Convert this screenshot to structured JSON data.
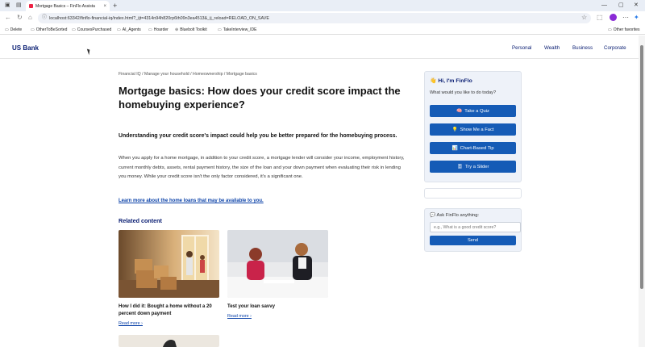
{
  "browser": {
    "tab_title": "Mortgage Basics – FinFlo Assista",
    "tab_close": "×",
    "new_tab": "+",
    "url": "localhost:63342/finflo-financial-iq/index.html?_ijt=4314n94h820rp6th09n3ea4513&_ij_reload=RELOAD_ON_SAVE",
    "bookmarks": [
      {
        "icon": "▭",
        "label": "Delete"
      },
      {
        "icon": "▭",
        "label": "OtherToBeSorted"
      },
      {
        "icon": "▭",
        "label": "CoursesPurchased"
      },
      {
        "icon": "▭",
        "label": "AI_Agents"
      },
      {
        "icon": "▭",
        "label": "Hoarder"
      },
      {
        "icon": "⊕",
        "label": "Bluebolt Toolkit"
      },
      {
        "icon": "▭",
        "label": "TakeInterview_IDE"
      }
    ],
    "other_favorites": "Other favorites",
    "icons": {
      "back": "←",
      "refresh": "↻",
      "home": "⌂",
      "site_info": "ⓘ",
      "star": "☆",
      "minimize": "—",
      "maximize": "▢",
      "close": "✕",
      "extensions": "⬚",
      "menu": "⋯"
    }
  },
  "site": {
    "brand": "US Bank",
    "nav": [
      "Personal",
      "Wealth",
      "Business",
      "Corporate"
    ]
  },
  "article": {
    "breadcrumb": "Financial IQ / Manage your household / Homeownership / Mortgage basics",
    "title": "Mortgage basics: How does your credit score impact the homebuying experience?",
    "subtitle": "Understanding your credit score's impact could help you be better prepared for the homebuying process.",
    "body": "When you apply for a home mortgage, in addition to your credit score, a mortgage lender will consider your income, employment history, current monthly debts, assets, rental payment history, the size of the loan and your down payment when evaluating their risk in lending you money. While your credit score isn't the only factor considered, it's a significant one.",
    "link": "Learn more about the home loans that may be available to you.",
    "related_heading": "Related content",
    "related": [
      {
        "title": "How I did it: Bought a home without a 20 percent down payment",
        "read_more": "Read more ›"
      },
      {
        "title": "Test your loan savvy",
        "read_more": "Read more ›"
      }
    ]
  },
  "finflo": {
    "greeting": "👋 Hi, I'm FinFlo",
    "prompt": "What would you like to do today?",
    "buttons": [
      {
        "icon": "🧠",
        "label": "Take a Quiz"
      },
      {
        "icon": "💡",
        "label": "Show Me a Fact"
      },
      {
        "icon": "📊",
        "label": "Chart-Based Tip"
      },
      {
        "icon": "🎚",
        "label": "Try a Slider"
      }
    ],
    "ask_label": "💬 Ask FinFlo anything:",
    "ask_placeholder": "e.g., What is a good credit score?",
    "send": "Send"
  },
  "colors": {
    "brand_navy": "#0c2074",
    "button_blue": "#155bb6",
    "link_blue": "#0a41a8",
    "panel_bg": "#eef2f9"
  }
}
